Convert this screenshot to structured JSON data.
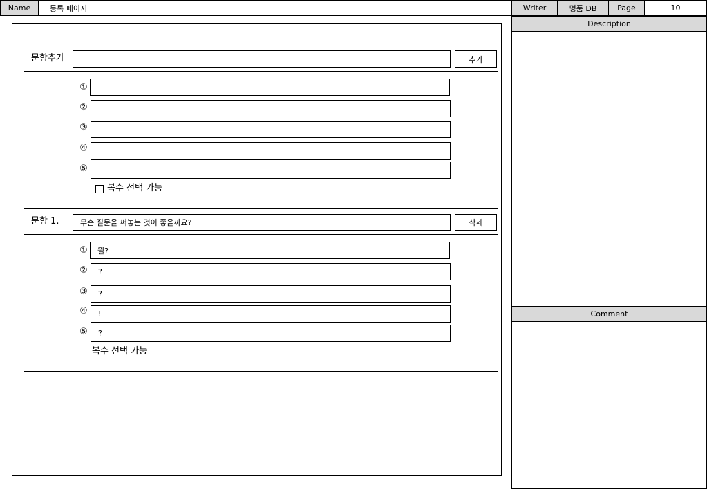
{
  "header": {
    "name_label": "Name",
    "name_value": "등록 페이지",
    "writer_label": "Writer",
    "writer_value": "명품 DB",
    "page_label": "Page",
    "page_value": "10"
  },
  "add_section": {
    "label": "문항추가",
    "input_value": "",
    "button_label": "추가",
    "option_numbers": [
      "①",
      "②",
      "③",
      "④",
      "⑤"
    ],
    "option_values": [
      "",
      "",
      "",
      "",
      ""
    ],
    "multi_select_label": "복수 선택 가능"
  },
  "question": {
    "label": "문항 1.",
    "text": "무슨 질문을 써놓는 것이 좋을까요?",
    "delete_label": "삭제",
    "option_numbers": [
      "①",
      "②",
      "③",
      "④",
      "⑤"
    ],
    "option_values": [
      "뭘?",
      "?",
      "?",
      "!",
      "?"
    ],
    "multi_select_label": "복수 선택 가능"
  },
  "right_panel": {
    "description_title": "Description",
    "comment_title": "Comment"
  }
}
